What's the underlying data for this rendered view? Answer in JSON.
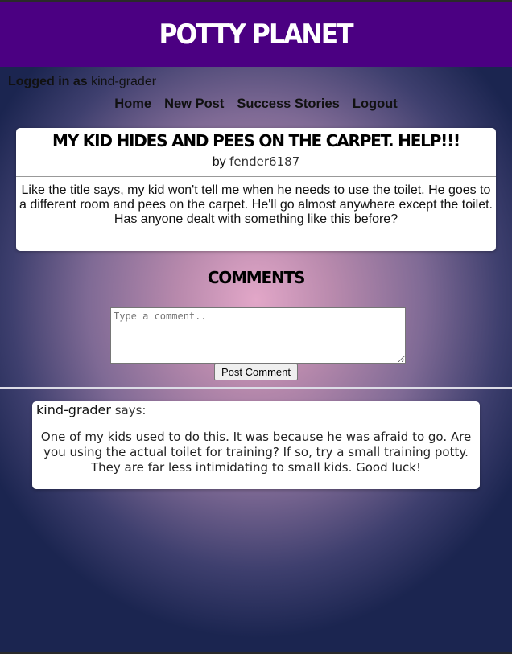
{
  "site": {
    "title": "POTTY PLANET"
  },
  "session": {
    "logged_in_label": "Logged in as",
    "username": "kind-grader"
  },
  "nav": {
    "items": [
      {
        "label": "Home"
      },
      {
        "label": "New Post"
      },
      {
        "label": "Success Stories"
      },
      {
        "label": "Logout"
      }
    ]
  },
  "post": {
    "title": "My kid hides and pees on the carpet. Help!!!",
    "by_label": "by",
    "author": "fender6187",
    "body": "Like the title says, my kid won't tell me when he needs to use the toilet. He goes to a different room and pees on the carpet. He'll go almost anywhere except the toilet. Has anyone dealt with something like this before?"
  },
  "comments_section": {
    "heading": "Comments",
    "placeholder": "Type a comment..",
    "submit_label": "Post Comment"
  },
  "comments": [
    {
      "user": "kind-grader",
      "says_label": "says:",
      "text": "One of my kids used to do this. It was because he was afraid to go. Are you using the actual toilet for training? If so, try a small training potty. They are far less intimidating to small kids. Good luck!"
    }
  ],
  "colors": {
    "header_bg": "#4b0082",
    "bg_center": "#e2a7c8",
    "bg_edge": "#1b2550"
  }
}
